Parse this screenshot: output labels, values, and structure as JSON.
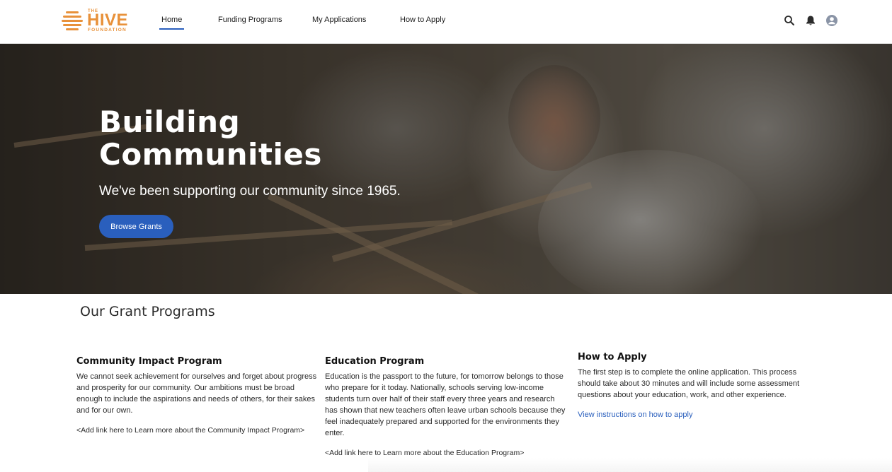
{
  "brand": {
    "the": "THE",
    "name": "HIVE",
    "sub": "FOUNDATION",
    "color": "#e8913a"
  },
  "nav": {
    "items": [
      {
        "label": "Home",
        "active": true
      },
      {
        "label": "Funding Programs",
        "active": false
      },
      {
        "label": "My Applications",
        "active": false
      },
      {
        "label": "How to Apply",
        "active": false
      }
    ]
  },
  "header_icons": [
    "search-icon",
    "bell-icon",
    "user-avatar-icon"
  ],
  "hero": {
    "title": "Building Communities",
    "subtitle": "We've been supporting our community since 1965.",
    "button": "Browse Grants"
  },
  "programs": {
    "title": "Our Grant Programs",
    "items": [
      {
        "heading": "Community Impact Program",
        "body": "We cannot seek achievement for ourselves and forget about progress and prosperity for our community. Our ambitions must be broad enough to include the aspirations and needs of others, for their sakes and for our own.",
        "more": "<Add link here to Learn more about the Community Impact Program>"
      },
      {
        "heading": "Education Program",
        "body": "Education is the passport to the future, for tomorrow belongs to those who prepare for it today. Nationally, schools serving low-income students turn over half of their staff every three years and research has shown that new teachers often leave urban schools because they feel inadequately prepared and supported for the environments they enter.",
        "more": "<Add link here to Learn more about the Education Program>"
      },
      {
        "heading": "How to Apply",
        "body": "The first step is to complete the online application. This process should take about 30 minutes and will include some assessment questions about your education, work, and other experience.",
        "link": "View instructions on how to apply"
      }
    ]
  },
  "colors": {
    "accent": "#2a5fbd",
    "brand": "#e8913a"
  }
}
